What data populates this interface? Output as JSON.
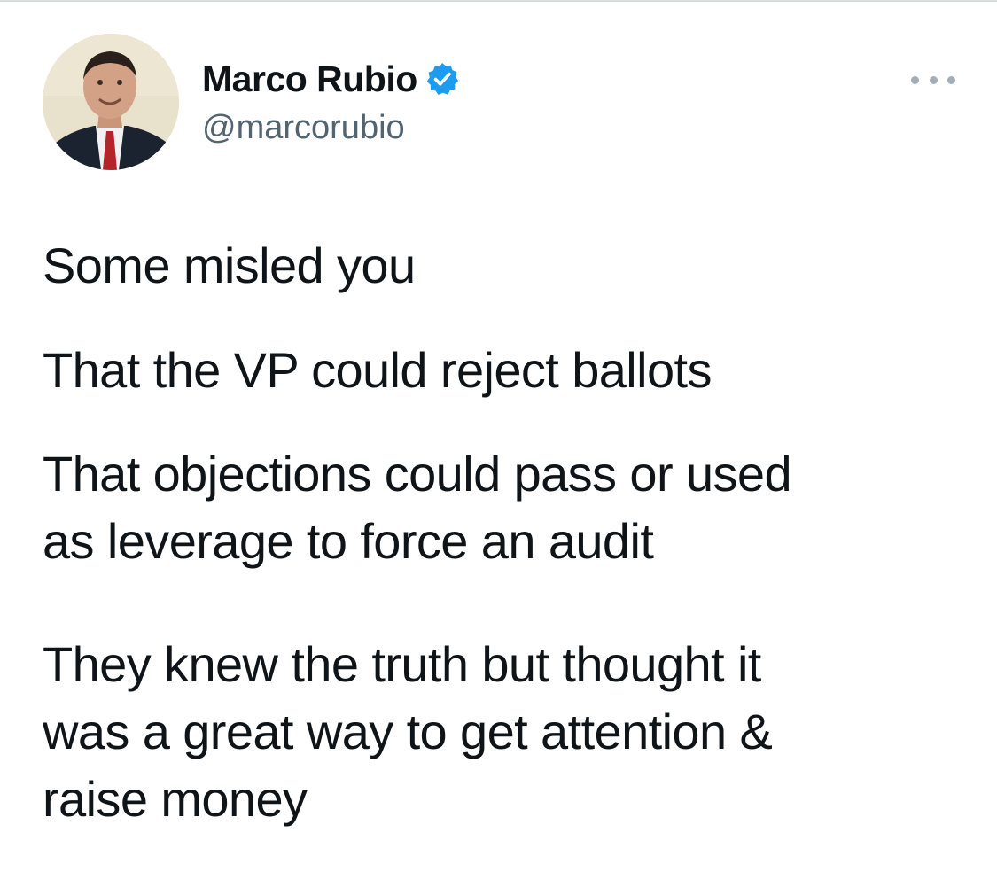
{
  "author": {
    "display_name": "Marco Rubio",
    "handle": "@marcorubio",
    "verified": true,
    "verified_icon": "verified-badge-icon",
    "verified_color": "#1d9bf0"
  },
  "more_icon": "more-horizontal-icon",
  "tweet": {
    "paragraphs": [
      [
        "Some misled you"
      ],
      [
        "That the VP could reject ballots"
      ],
      [
        "That objections could pass or used",
        "as leverage to force an audit"
      ],
      [
        "They knew the truth but thought it",
        "was a great way to get attention &",
        "raise money"
      ]
    ]
  },
  "colors": {
    "text": "#0f1419",
    "secondary": "#536471",
    "background": "#ffffff"
  }
}
